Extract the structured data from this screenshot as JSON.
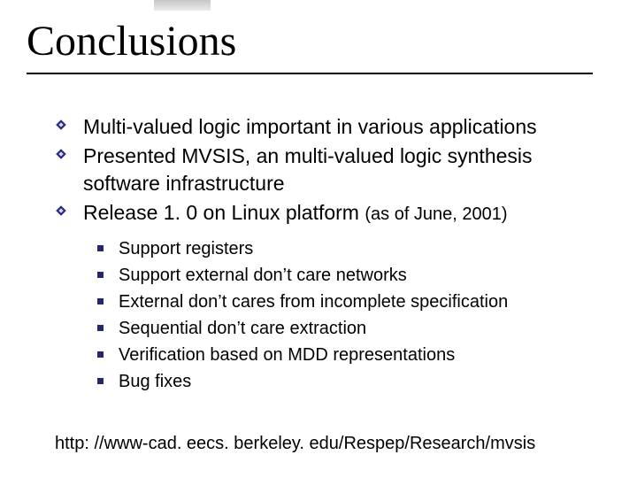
{
  "title": "Conclusions",
  "bullets": {
    "b0": "Multi-valued logic important in various applications",
    "b1": "Presented MVSIS, an multi-valued logic synthesis software infrastructure",
    "b2_main": "Release 1. 0 on Linux platform ",
    "b2_note": "(as of June, 2001)"
  },
  "sub": {
    "s0": "Support registers",
    "s1": "Support external don’t care networks",
    "s2": "External don’t cares from incomplete specification",
    "s3": "Sequential don’t care extraction",
    "s4": "Verification based on MDD representations",
    "s5": "Bug fixes"
  },
  "url": "http: //www-cad. eecs. berkeley. edu/Respep/Research/mvsis"
}
